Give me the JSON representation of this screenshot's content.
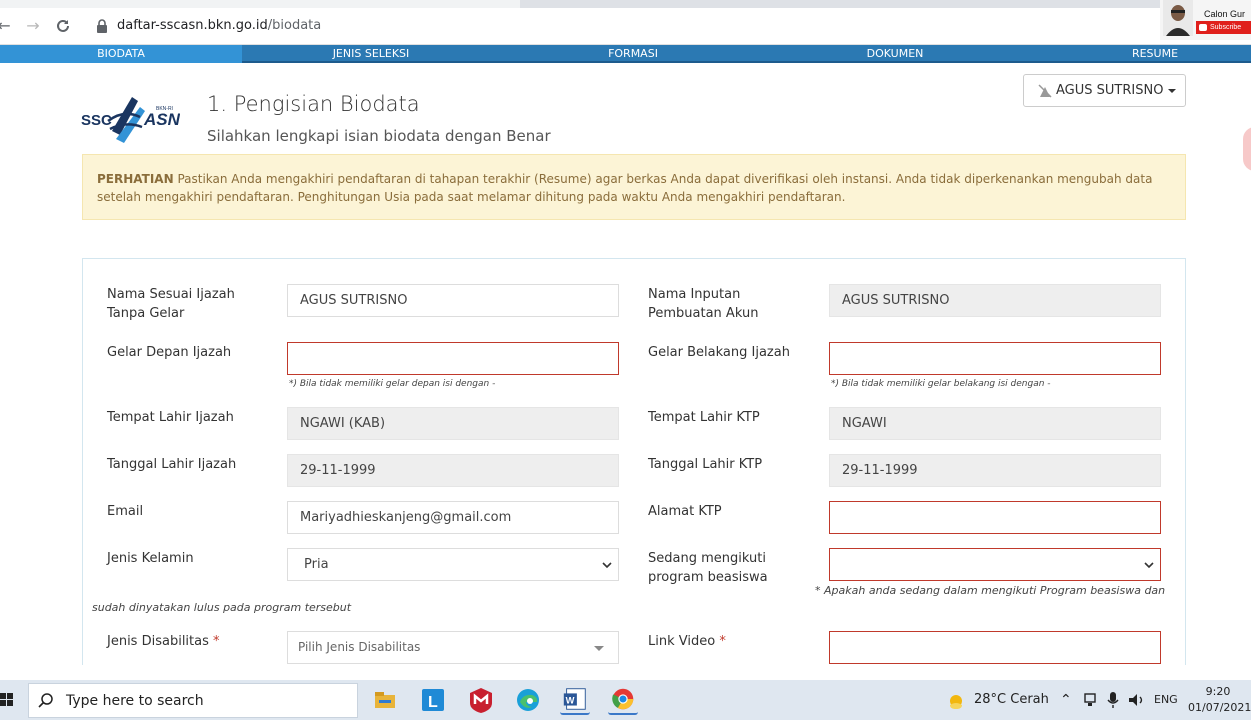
{
  "browser": {
    "url_domain": "daftar-sscasn.bkn.go.id",
    "url_path": "/biodata",
    "webcam_name": "Calon Gur",
    "subscribe_label": "Subscribe"
  },
  "steps": [
    {
      "label": "BIODATA",
      "active": true
    },
    {
      "label": "JENIS SELEKSI"
    },
    {
      "label": "FORMASI"
    },
    {
      "label": "DOKUMEN"
    },
    {
      "label": "RESUME"
    }
  ],
  "header": {
    "title": "1. Pengisian Biodata",
    "subtitle": "Silahkan lengkapi isian biodata dengan Benar",
    "user_name": "AGUS SUTRISNO",
    "logo_text_left": "SSC",
    "logo_text_right": "ASN",
    "logo_small": "BKN-RI"
  },
  "alert": {
    "strong": "PERHATIAN",
    "text": " Pastikan Anda mengakhiri pendaftaran di tahapan terakhir (Resume) agar berkas Anda dapat diverifikasi oleh instansi. Anda tidak diperkenankan mengubah data setelah mengakhiri pendaftaran. Penghitungan Usia pada saat melamar dihitung pada waktu Anda mengakhiri pendaftaran."
  },
  "form": {
    "nama_ijazah_label": "Nama Sesuai Ijazah Tanpa Gelar",
    "nama_ijazah_value": "AGUS SUTRISNO",
    "nama_akun_label": "Nama Inputan Pembuatan Akun",
    "nama_akun_value": "AGUS SUTRISNO",
    "gelar_depan_label": "Gelar Depan Ijazah",
    "gelar_depan_value": "",
    "gelar_depan_hint": "*) Bila tidak memiliki gelar depan isi dengan -",
    "gelar_belakang_label": "Gelar Belakang Ijazah",
    "gelar_belakang_value": "",
    "gelar_belakang_hint": "*) Bila tidak memiliki gelar belakang isi dengan -",
    "tempat_lahir_ijazah_label": "Tempat Lahir Ijazah",
    "tempat_lahir_ijazah_value": "NGAWI (KAB)",
    "tempat_lahir_ktp_label": "Tempat Lahir KTP",
    "tempat_lahir_ktp_value": "NGAWI",
    "tanggal_lahir_ijazah_label": "Tanggal Lahir Ijazah",
    "tanggal_lahir_ijazah_value": "29-11-1999",
    "tanggal_lahir_ktp_label": "Tanggal Lahir KTP",
    "tanggal_lahir_ktp_value": "29-11-1999",
    "email_label": "Email",
    "email_value": "Mariyadhieskanjeng@gmail.com",
    "alamat_ktp_label": "Alamat KTP",
    "alamat_ktp_value": "",
    "jenis_kelamin_label": "Jenis Kelamin",
    "jenis_kelamin_value": "Pria",
    "beasiswa_label": "Sedang mengikuti program beasiswa",
    "beasiswa_value": "",
    "beasiswa_hint_a": "* Apakah anda sedang dalam mengikuti Program beasiswa dan",
    "beasiswa_hint_b": "sudah dinyatakan lulus pada program tersebut",
    "disabilitas_label": "Jenis Disabilitas",
    "disabilitas_placeholder": "Pilih Jenis Disabilitas",
    "link_video_label": "Link Video",
    "link_video_value": "",
    "required_mark": "*"
  },
  "taskbar": {
    "search_placeholder": "Type here to search",
    "weather": "28°C  Cerah",
    "lang": "ENG",
    "time": "9:20",
    "date": "01/07/2021"
  },
  "colors": {
    "stepbar": "#2b79b3",
    "step_active": "#3393d6",
    "alert_bg": "#fcf4d6",
    "error_border": "#c0392b"
  }
}
